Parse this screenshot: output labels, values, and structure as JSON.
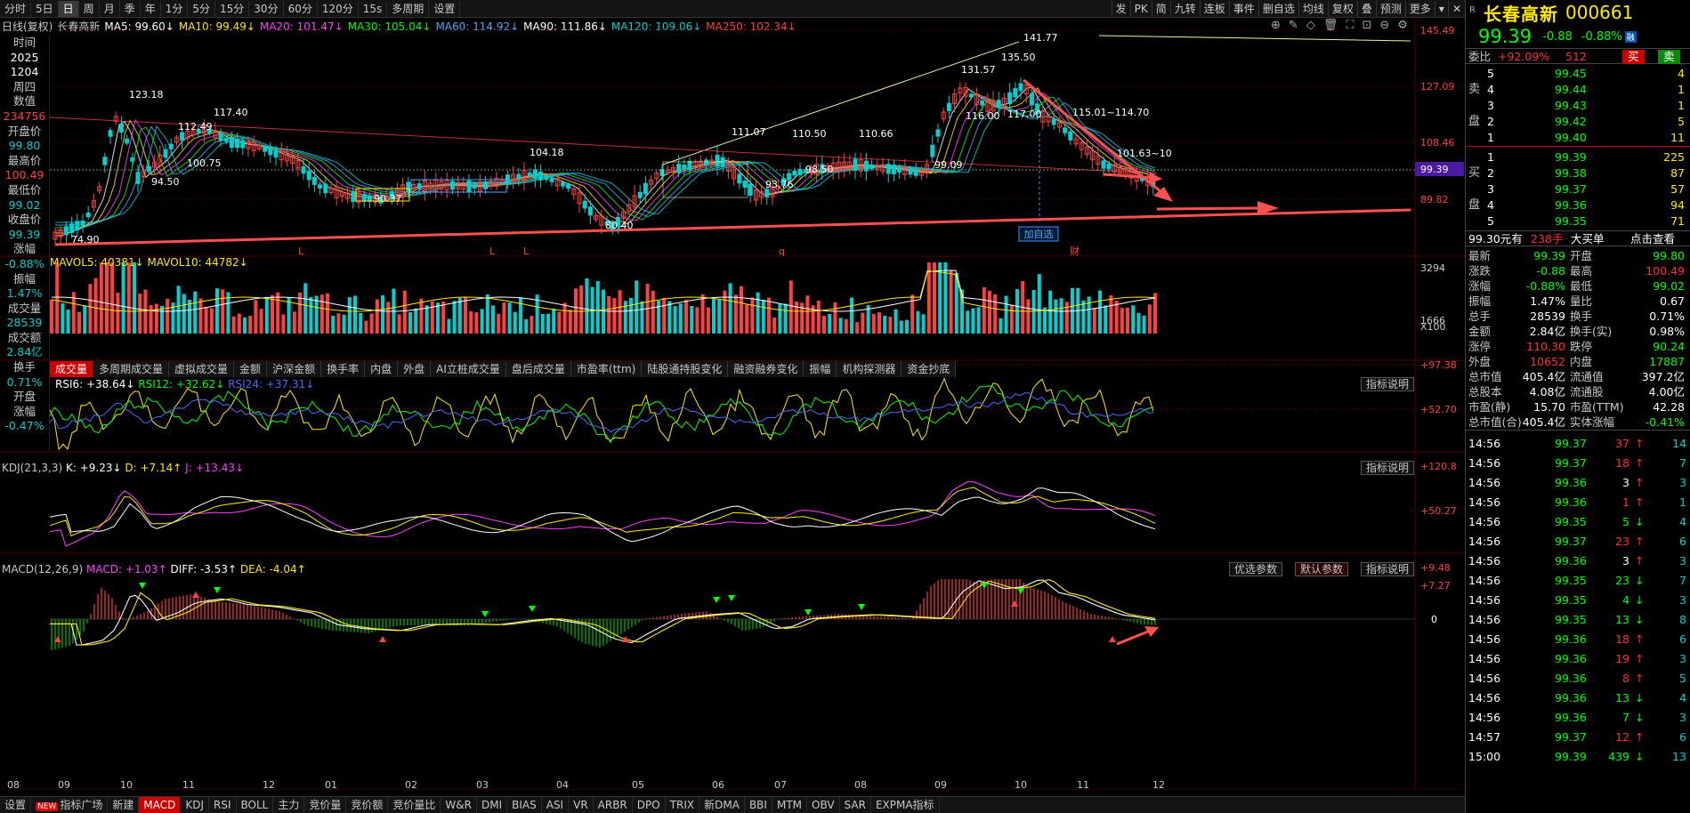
{
  "toolbar": {
    "periods": [
      "分时",
      "5日",
      "日",
      "周",
      "月",
      "季",
      "年",
      "1分",
      "5分",
      "15分",
      "30分",
      "60分",
      "120分",
      "15s",
      "多周期",
      "设置"
    ],
    "active_period": "日",
    "right_buttons": [
      "发",
      "PK",
      "简",
      "九转",
      "连板",
      "事件",
      "删自选",
      "均线",
      "复权",
      "叠",
      "预测",
      "更多"
    ]
  },
  "ma_bar": {
    "prefix": "日线(复权)",
    "stock": "长春高新",
    "items": [
      {
        "text": "MA5: 99.60↓",
        "color": "#ffffff"
      },
      {
        "text": "MA10: 99.49↓",
        "color": "#ffea00"
      },
      {
        "text": "MA20: 101.47↓",
        "color": "#ff40ff"
      },
      {
        "text": "MA30: 105.04↓",
        "color": "#00ff00"
      },
      {
        "text": "MA60: 114.92↓",
        "color": "#4aa8ff"
      },
      {
        "text": "MA90: 111.86↓",
        "color": "#ffffff"
      },
      {
        "text": "MA120: 109.06↓",
        "color": "#00d0d0"
      },
      {
        "text": "MA250: 102.34↓",
        "color": "#ff4040"
      }
    ]
  },
  "left_panel": [
    {
      "label": "时间"
    },
    {
      "value": "2025",
      "c": "vw"
    },
    {
      "value": "1204",
      "c": "vw"
    },
    {
      "label": "周四"
    },
    {
      "label": "数值"
    },
    {
      "value": "234756",
      "c": "vr"
    },
    {
      "label": "开盘价"
    },
    {
      "value": "99.80",
      "c": "vg"
    },
    {
      "label": "最高价"
    },
    {
      "value": "100.49",
      "c": "vr"
    },
    {
      "label": "最低价"
    },
    {
      "value": "99.02",
      "c": "vg"
    },
    {
      "label": "收盘价"
    },
    {
      "value": "99.39",
      "c": "vg"
    },
    {
      "label": "涨幅"
    },
    {
      "value": "-0.88%",
      "c": "vg"
    },
    {
      "label": "振幅"
    },
    {
      "value": "1.47%",
      "c": "vg"
    },
    {
      "label": "成交量"
    },
    {
      "value": "28539",
      "c": "vg"
    },
    {
      "label": "成交额"
    },
    {
      "value": "2.84亿",
      "c": "vg"
    },
    {
      "label": "换手"
    },
    {
      "value": "0.71%",
      "c": "vg"
    },
    {
      "label": "开盘"
    },
    {
      "label": "涨幅"
    },
    {
      "value": "-0.47%",
      "c": "vg"
    }
  ],
  "price_axis": [
    "145.49",
    "127.09",
    "108.46",
    "89.82"
  ],
  "price_tag": "99.39",
  "annotations": {
    "peak1": "123.18",
    "low1": "74.90",
    "p117": "117.40",
    "p112": "112.49",
    "p100": "100.75",
    "p94": "94.50",
    "p104": "104.18",
    "p90": "90.37",
    "p80": "80.40",
    "p111": "111.07",
    "p110": "110.50",
    "p110b": "110.66",
    "p98": "98.50",
    "p99": "99.09",
    "p93": "93.76",
    "p131": "131.57",
    "p135": "135.50",
    "p141": "141.77",
    "p116": "116.00",
    "p117b": "117.00",
    "p115": "115.01~114.70",
    "p101": "101.63~10"
  },
  "marks": [
    "L",
    "L",
    "L",
    "q",
    "财"
  ],
  "add_watch": "加自选",
  "volume": {
    "title": "MAVOL5: 40381↓  MAVOL10: 44782↓",
    "axis": [
      "3294",
      "1666",
      "X100"
    ]
  },
  "indicator_tabs": [
    "成交量",
    "多周期成交量",
    "虚拟成交量",
    "金额",
    "沪深金额",
    "换手率",
    "内盘",
    "外盘",
    "AI立桩成交量",
    "盘后成交量",
    "市盈率(ttm)",
    "陆股通持股变化",
    "融资融券变化",
    "振幅",
    "机构探测器",
    "资金抄底"
  ],
  "rsi": {
    "title_a": "RSI6: +38.64↓",
    "title_b": "RSI12: +32.62↓",
    "title_c": "RSI24: +37.31↓",
    "axis": [
      "+97.38",
      "+52.70"
    ],
    "btn": "指标说明"
  },
  "kdj": {
    "title": "KDJ(21,3,3)",
    "k": "K: +9.23↓",
    "d": "D: +7.14↑",
    "j": "J: +13.43↓",
    "axis": [
      "+120.8",
      "+50.27"
    ],
    "btn": "指标说明"
  },
  "macd": {
    "title": "MACD(12,26,9)",
    "m": "MACD: +1.03↑",
    "diff": "DIFF: -3.53↑",
    "dea": "DEA: -4.04↑",
    "axis": [
      "+9.48",
      "+7.27",
      "0"
    ],
    "btn1": "优选参数",
    "btn2": "默认参数",
    "btn3": "指标说明"
  },
  "months": [
    "08",
    "09",
    "10",
    "11",
    "12",
    "01",
    "02",
    "03",
    "04",
    "05",
    "06",
    "07",
    "08",
    "09",
    "10",
    "11",
    "12"
  ],
  "bottom_tabs": [
    "设置",
    "指标广场",
    "新建",
    "MACD",
    "KDJ",
    "RSI",
    "BOLL",
    "主力",
    "竞价量",
    "竞价额",
    "竞价量比",
    "W&R",
    "DMI",
    "BIAS",
    "ASI",
    "VR",
    "ARBR",
    "DPO",
    "TRIX",
    "新DMA",
    "BBI",
    "MTM",
    "OBV",
    "SAR",
    "EXPMA指标"
  ],
  "bottom_active": "MACD",
  "right": {
    "r_badge": "R",
    "name": "长春高新",
    "code": "000661",
    "price": "99.39",
    "chg": "-0.88",
    "pct": "-0.88%",
    "rong": "融",
    "weibi_label": "委比",
    "weibi": "+92.09%",
    "weicha": "512",
    "buy_btn": "买",
    "sell_btn": "卖",
    "sell_side_label": "卖盘",
    "buy_side_label": "买盘",
    "asks": [
      {
        "n": "5",
        "p": "99.45",
        "v": "4"
      },
      {
        "n": "4",
        "p": "99.44",
        "v": "1"
      },
      {
        "n": "3",
        "p": "99.43",
        "v": "1"
      },
      {
        "n": "2",
        "p": "99.42",
        "v": "5"
      },
      {
        "n": "1",
        "p": "99.40",
        "v": "11"
      }
    ],
    "bids": [
      {
        "n": "1",
        "p": "99.39",
        "v": "225"
      },
      {
        "n": "2",
        "p": "99.38",
        "v": "87"
      },
      {
        "n": "3",
        "p": "99.37",
        "v": "57"
      },
      {
        "n": "4",
        "p": "99.36",
        "v": "94"
      },
      {
        "n": "5",
        "p": "99.35",
        "v": "71"
      }
    ],
    "big_order": {
      "a": "99.30元有",
      "b": "238手",
      "c": "大买单",
      "d": "点击查看"
    },
    "stats": [
      [
        "最新",
        "99.39",
        "g",
        "开盘",
        "99.80",
        "g"
      ],
      [
        "涨跌",
        "-0.88",
        "g",
        "最高",
        "100.49",
        "r"
      ],
      [
        "涨幅",
        "-0.88%",
        "g",
        "最低",
        "99.02",
        "g"
      ],
      [
        "振幅",
        "1.47%",
        "w",
        "量比",
        "0.67",
        "w"
      ],
      [
        "总手",
        "28539",
        "w",
        "换手",
        "0.71%",
        "w"
      ],
      [
        "金额",
        "2.84亿",
        "w",
        "换手(实)",
        "0.98%",
        "w"
      ],
      [
        "涨停",
        "110.30",
        "r",
        "跌停",
        "90.24",
        "g"
      ],
      [
        "外盘",
        "10652",
        "r",
        "内盘",
        "17887",
        "g"
      ],
      [
        "总市值",
        "405.4亿",
        "w",
        "流通值",
        "397.2亿",
        "w"
      ],
      [
        "总股本",
        "4.08亿",
        "w",
        "流通股",
        "4.00亿",
        "w"
      ],
      [
        "市盈(静)",
        "15.70",
        "w",
        "市盈(TTM)",
        "42.28",
        "w"
      ],
      [
        "总市值(合)",
        "405.4亿",
        "w",
        "实体涨幅",
        "-0.41%",
        "g"
      ]
    ],
    "ticks": [
      [
        "14:56",
        "99.37",
        "37",
        "r",
        "↑",
        "14"
      ],
      [
        "14:56",
        "99.37",
        "18",
        "r",
        "↑",
        "7"
      ],
      [
        "14:56",
        "99.36",
        "3",
        "w",
        "↑",
        "3"
      ],
      [
        "14:56",
        "99.36",
        "1",
        "r",
        "↑",
        "1"
      ],
      [
        "14:56",
        "99.35",
        "5",
        "g",
        "↓",
        "4"
      ],
      [
        "14:56",
        "99.37",
        "23",
        "r",
        "↑",
        "6"
      ],
      [
        "14:56",
        "99.36",
        "3",
        "w",
        "↑",
        "3"
      ],
      [
        "14:56",
        "99.35",
        "23",
        "g",
        "↓",
        "7"
      ],
      [
        "14:56",
        "99.35",
        "4",
        "g",
        "↓",
        "3"
      ],
      [
        "14:56",
        "99.35",
        "13",
        "g",
        "↓",
        "8"
      ],
      [
        "14:56",
        "99.36",
        "18",
        "r",
        "↑",
        "6"
      ],
      [
        "14:56",
        "99.36",
        "19",
        "r",
        "↑",
        "3"
      ],
      [
        "14:56",
        "99.36",
        "8",
        "r",
        "↑",
        "5"
      ],
      [
        "14:56",
        "99.36",
        "13",
        "g",
        "↓",
        "4"
      ],
      [
        "14:56",
        "99.36",
        "7",
        "g",
        "↓",
        "3"
      ],
      [
        "14:57",
        "99.37",
        "12",
        "r",
        "↑",
        "6"
      ],
      [
        "15:00",
        "99.39",
        "439",
        "g",
        "↓",
        "13"
      ]
    ]
  }
}
